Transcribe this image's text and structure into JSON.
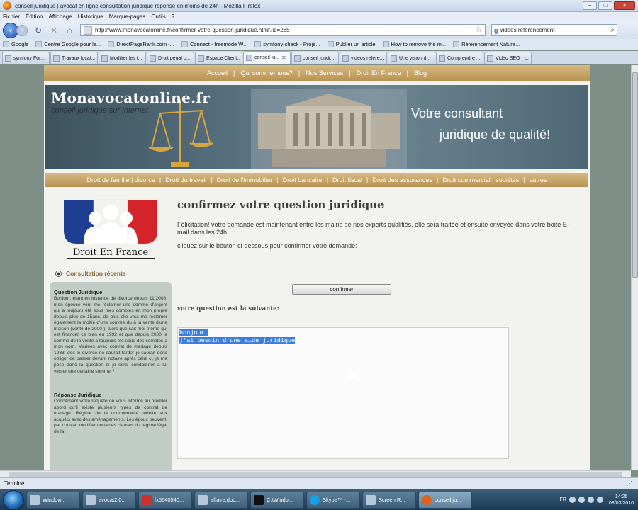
{
  "window": {
    "title": "conseil juridique | avocat en ligne consultation juridique reponse en moins de 24h - Mozilla Firefox"
  },
  "menu": [
    "Fichier",
    "Édition",
    "Affichage",
    "Historique",
    "Marque-pages",
    "Outils",
    "?"
  ],
  "nav": {
    "url": "http://www.monavocatonline.fr/confirmer-votre-question-juridique.html?id=285",
    "search_engine": "g",
    "search_query": "videos referencement"
  },
  "bookmarks": [
    "Google",
    "Centre Google pour le...",
    "DirectPageRank.com -...",
    "Connect - freemode W...",
    "symfony-check - Proje...",
    "Publier un article",
    "How to remove the m...",
    "Référencement Nature..."
  ],
  "tabs": [
    {
      "label": "symfony For..."
    },
    {
      "label": "Travaux locat..."
    },
    {
      "label": "Modifier les t..."
    },
    {
      "label": "Droit pénal c..."
    },
    {
      "label": "Espace Client..."
    },
    {
      "label": "conseil ju...",
      "active": true
    },
    {
      "label": "conseil juridi..."
    },
    {
      "label": "videos refere..."
    },
    {
      "label": "Une vision d..."
    },
    {
      "label": "Comprendre ..."
    },
    {
      "label": "Vidéo SEO : L..."
    }
  ],
  "site": {
    "topnav": [
      "Accueil",
      "Qui somme-nous?",
      "Nos Services",
      "Droit En France",
      "Blog"
    ],
    "brand": "Monavocatonline.fr",
    "tagline": "conseil juridique sur internet",
    "slogan_line1": "Votre consultant",
    "slogan_line2": "juridique de qualité!",
    "categories": [
      "Droit de famille | divorce",
      "Droit du travail",
      "Droit de l'immobilier",
      "Droit bancaire",
      "Droit fiscal",
      "Droit des assurances",
      "Droit commercial | sociétés",
      "autres"
    ],
    "logo_caption": "Droit En France",
    "recent_heading": "Consultation récente",
    "sidebar": {
      "q_title": "Question Juridique",
      "q_text": "Bonjour, étant en instance de divorce depuis 11/2008, mon épouse veut me réclamer une somme d'argent qui a toujours été sous mes comptes en mon propre depuis plus de 15ans, de plus elle veut me réclamer également la moitié d'une somme du à la vente d'une maison (vente de 2000 ), alors que sait moi même qui est financer ce bien en 1992 et que depuis 2000 la somme de la vente a toujours été sous des comptes a mon nom. Mariées avec contrat de mariage depuis 1988, doit le divorce ne saurait tarder je saurait donc obliger de passer devant notaire après celui ci, je me pose donc la question si je serai condamner a lui verser une certaine somme ?",
      "a_title": "Réponse Juridique",
      "a_text": "Concernant votre requête on vous informe au premier abord qu'il existe plusieurs types de contrat de mariage. Régime de la communauté réduite aux acquêts avec des aménagements. Les époux peuvent, par contrat, modifier certaines clauses du régime légal de la"
    },
    "main": {
      "title": "confirmez votre question juridique",
      "message": "Félicitation! votre demande est maintenant entre les mains de nos experts qualifiés, elle sera traitée et ensuite envoyée dans votre boite E-mail dans les 24h .",
      "instruction": "cliquez sur le bouton ci-dessous pour confirmer votre demande:",
      "confirm_label": "confirmer",
      "question_label": "votre question est la suivante:",
      "question_line1": "bonjour,",
      "question_line2": "j'ai besoin d'une aide juridique"
    }
  },
  "status": "Terminé",
  "taskbar": {
    "items": [
      "Window...",
      "avocat2.0...",
      "fx5640540...",
      "affaire.doc...",
      "C:\\Windo...",
      "Skype™ -...",
      "Screen R...",
      "conseil ju..."
    ],
    "lang": "FR",
    "time": "14:26",
    "date": "08/03/2010"
  }
}
